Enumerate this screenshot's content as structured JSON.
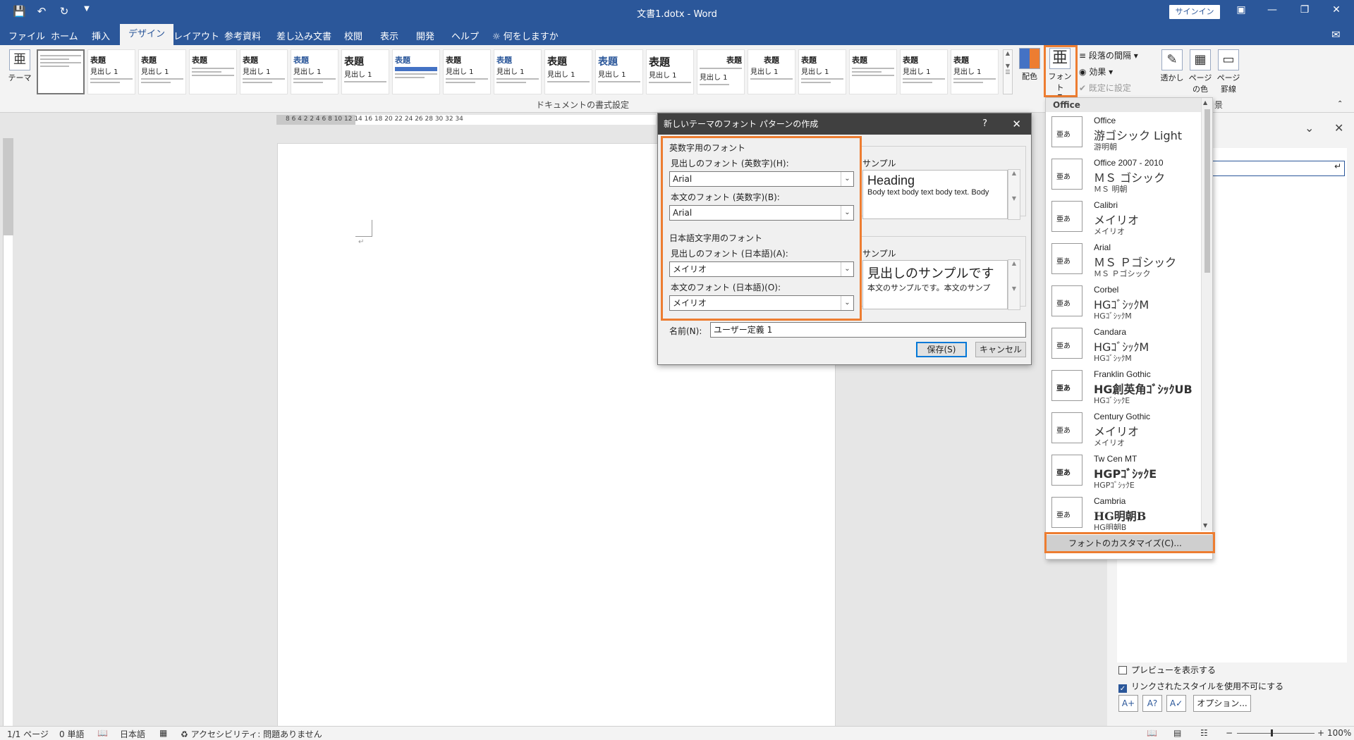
{
  "titlebar": {
    "title": "文書1.dotx - Word",
    "signin": "サインイン"
  },
  "tabs": [
    "ファイル",
    "ホーム",
    "挿入",
    "デザイン",
    "レイアウト",
    "参考資料",
    "差し込み文書",
    "校閲",
    "表示",
    "開発",
    "ヘルプ",
    "何をしますか"
  ],
  "active_tab": "デザイン",
  "ribbon": {
    "theme_label": "テーマ",
    "group_label": "ドキュメントの書式設定",
    "gallery_title": "表題",
    "gallery_heading": "見出し 1",
    "colors_label": "配色",
    "fonts_label": "フォント",
    "paragraph_spacing": "段落の間隔",
    "effects": "効果",
    "set_default": "既定に設定",
    "watermark": "透かし",
    "page_color": "ページの色",
    "page_borders": "ページ罫線",
    "background_partial": "景"
  },
  "ruler": {
    "numbers": "8  6  4  2     2  4  6  8  10  12  14  16  18  20  22  24  26  28  30  32  34"
  },
  "dialog": {
    "title": "新しいテーマのフォント パターンの作成",
    "help": "?",
    "latin_group": "英数字用のフォント",
    "latin_heading_label": "見出しのフォント (英数字)(H):",
    "latin_heading_value": "Arial",
    "latin_body_label": "本文のフォント (英数字)(B):",
    "latin_body_value": "Arial",
    "sample_label": "サンプル",
    "sample_heading": "Heading",
    "sample_body": "Body text body text body text. Body",
    "jp_group": "日本語文字用のフォント",
    "jp_heading_label": "見出しのフォント (日本語)(A):",
    "jp_heading_value": "メイリオ",
    "jp_body_label": "本文のフォント (日本語)(O):",
    "jp_body_value": "メイリオ",
    "jp_sample_label": "サンプル",
    "jp_sample_heading": "見出しのサンプルです",
    "jp_sample_body": "本文のサンプルです。本文のサンプ",
    "name_label": "名前(N):",
    "name_value": "ユーザー定義 1",
    "save": "保存(S)",
    "cancel": "キャンセル"
  },
  "fontmenu": {
    "header": "Office",
    "preview_glyph": "亜あ",
    "items": [
      {
        "name": "Office",
        "heading": "游ゴシック Light",
        "body": "游明朝"
      },
      {
        "name": "Office 2007 - 2010",
        "heading": "ＭＳ ゴシック",
        "body": "ＭＳ 明朝"
      },
      {
        "name": "Calibri",
        "heading": "メイリオ",
        "body": "メイリオ"
      },
      {
        "name": "Arial",
        "heading": "ＭＳ Ｐゴシック",
        "body": "ＭＳ Ｐゴシック"
      },
      {
        "name": "Corbel",
        "heading": "HGｺﾞｼｯｸM",
        "body": "HGｺﾞｼｯｸM"
      },
      {
        "name": "Candara",
        "heading": "HGｺﾞｼｯｸM",
        "body": "HGｺﾞｼｯｸM"
      },
      {
        "name": "Franklin Gothic",
        "heading": "HG創英角ｺﾞｼｯｸUB",
        "body": "HGｺﾞｼｯｸE"
      },
      {
        "name": "Century Gothic",
        "heading": "メイリオ",
        "body": "メイリオ"
      },
      {
        "name": "Tw Cen MT",
        "heading": "HGPｺﾞｼｯｸE",
        "body": "HGPｺﾞｼｯｸE"
      },
      {
        "name": "Cambria",
        "heading": "HG明朝B",
        "body": "HG明朝B"
      }
    ],
    "customize": "フォントのカスタマイズ(C)..."
  },
  "pane": {
    "preview_label": "プレビューを表示する",
    "linked_label": "リンクされたスタイルを使用不可にする",
    "options": "オプション..."
  },
  "status": {
    "page": "1/1 ページ",
    "words": "0 単語",
    "language": "日本語",
    "accessibility": "アクセシビリティ: 問題ありません",
    "zoom": "100%"
  },
  "colors": {
    "accent": "#2b579a",
    "highlight": "#ed7d31"
  }
}
